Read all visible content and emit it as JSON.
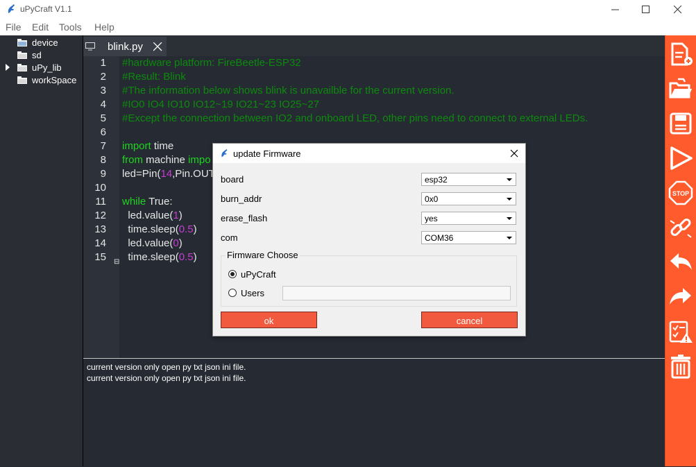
{
  "window": {
    "title": "uPyCraft V1.1"
  },
  "menu": [
    "File",
    "Edit",
    "Tools",
    "Help"
  ],
  "tree": [
    {
      "label": "device",
      "expandable": false
    },
    {
      "label": "sd",
      "expandable": false
    },
    {
      "label": "uPy_lib",
      "expandable": true
    },
    {
      "label": "workSpace",
      "expandable": false
    }
  ],
  "tab": {
    "label": "blink.py"
  },
  "editor": {
    "lines": [
      {
        "n": "1",
        "html": "<span class='cm'>#hardware platform: FireBeetle-ESP32</span>"
      },
      {
        "n": "2",
        "html": "<span class='cm'>#Result: Blink</span>"
      },
      {
        "n": "3",
        "html": "<span class='cm'>#The information below shows blink is unavailble for the current version.</span>"
      },
      {
        "n": "4",
        "html": "<span class='cm'>#IO0 IO4 IO10 IO12~19 IO21~23 IO25~27</span>"
      },
      {
        "n": "5",
        "html": "<span class='cm'>#Except the connection between IO2 and onboard LED, other pins need to connect to external LEDs.</span>"
      },
      {
        "n": "6",
        "html": ""
      },
      {
        "n": "7",
        "html": "<span class='kw'>import</span> time"
      },
      {
        "n": "8",
        "html": "<span class='kw'>from</span> machine <span class='kw'>impo</span>"
      },
      {
        "n": "9",
        "html": "led=Pin(<span class='num'>14</span>,Pin.OUT"
      },
      {
        "n": "10",
        "html": ""
      },
      {
        "n": "11",
        "html": "<span class='kw'>while</span> True:"
      },
      {
        "n": "12",
        "html": "  led.value(<span class='num'>1</span>)"
      },
      {
        "n": "13",
        "html": "  time.sleep(<span class='num'>0.5</span>)"
      },
      {
        "n": "14",
        "html": "  led.value(<span class='num'>0</span>)"
      },
      {
        "n": "15",
        "html": "  time.sleep(<span class='num'>0.5</span>)"
      }
    ]
  },
  "console": {
    "lines": [
      "current version only open py txt json ini file.",
      "current version only open py txt json ini file."
    ]
  },
  "toolbar": [
    "new-file-icon",
    "open-folder-icon",
    "save-icon",
    "run-icon",
    "stop-icon",
    "connect-icon",
    "undo-icon",
    "redo-icon",
    "syntax-check-icon",
    "clear-icon"
  ],
  "dialog": {
    "title": "update Firmware",
    "board_label": "board",
    "board_value": "esp32",
    "burn_addr_label": "burn_addr",
    "burn_addr_value": "0x0",
    "erase_flash_label": "erase_flash",
    "erase_flash_value": "yes",
    "com_label": "com",
    "com_value": "COM36",
    "group_title": "Firmware Choose",
    "option_upycraft": "uPyCraft",
    "option_users": "Users",
    "selected_option": "uPyCraft",
    "ok_label": "ok",
    "cancel_label": "cancel"
  },
  "colors": {
    "toolbar_bg": "#ff5b2d",
    "editor_bg": "#262b33",
    "comment": "#0c8a0c",
    "keyword": "#1fd41f",
    "number": "#c83bd3",
    "dialog_button": "#f15a3e"
  }
}
